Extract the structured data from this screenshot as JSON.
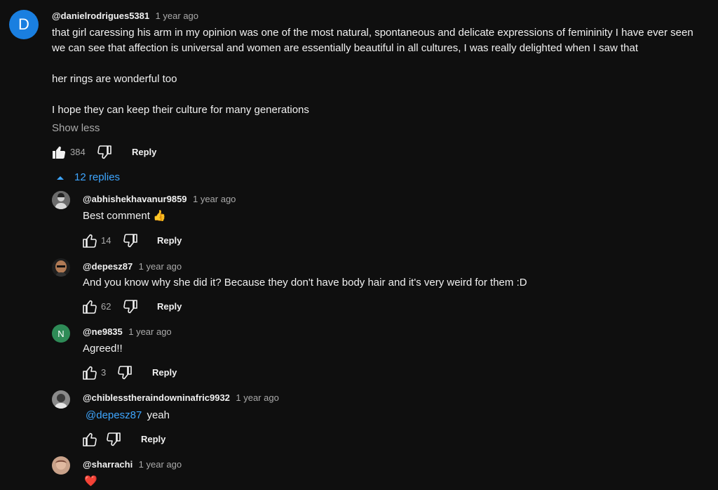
{
  "top": {
    "avatar_letter": "D",
    "avatar_color": "#1a7fe0",
    "handle": "@danielrodrigues5381",
    "time": "1 year ago",
    "lines": [
      "that girl caressing his arm in my opinion was one of the most natural, spontaneous and delicate expressions of femininity I have ever seen",
      "we can see that affection is universal and women are essentially beautiful in all cultures, I was really delighted when I saw that",
      "her rings are wonderful too",
      "I hope they can keep their culture for many generations"
    ],
    "show_less": "Show less",
    "likes": "384",
    "reply_label": "Reply"
  },
  "replies_toggle": {
    "label": "12 replies",
    "icon": "caret-up-icon",
    "color": "#3ea6ff"
  },
  "replies": [
    {
      "handle": "@abhishekhavanur9859",
      "time": "1 year ago",
      "text": "Best comment 👍",
      "likes": "14",
      "reply_label": "Reply"
    },
    {
      "handle": "@depesz87",
      "time": "1 year ago",
      "text": "And you know why she did it? Because they don't have body hair and it's very weird for them :D",
      "likes": "62",
      "reply_label": "Reply"
    },
    {
      "handle": "@ne9835",
      "time": "1 year ago",
      "text": "Agreed!!",
      "likes": "3",
      "reply_label": "Reply",
      "avatar_letter": "N",
      "avatar_color": "#2e8b57"
    },
    {
      "handle": "@chiblesstheraindowninafric9932",
      "time": "1 year ago",
      "mention": "@depesz87",
      "text": "yeah",
      "likes": "",
      "reply_label": "Reply"
    },
    {
      "handle": "@sharrachi",
      "time": "1 year ago",
      "text": "❤️"
    }
  ]
}
